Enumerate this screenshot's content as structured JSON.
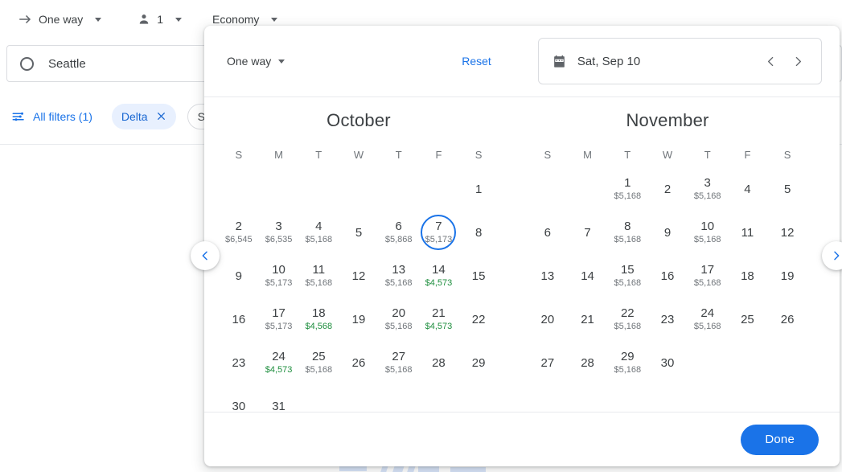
{
  "trip_bar": {
    "trip_type": "One way",
    "passengers": "1",
    "cabin": "Economy",
    "arrow_icon": "arrow-right-icon",
    "person_icon": "person-icon"
  },
  "origin": {
    "value": "Seattle",
    "icon": "circle-outline-icon"
  },
  "filters": {
    "all_filters_label": "All filters (1)",
    "tune_icon": "tune-icon",
    "chips": [
      {
        "label": "Delta",
        "removable": true,
        "close_icon": "close-icon"
      },
      {
        "label": "St",
        "removable": false
      }
    ]
  },
  "modal": {
    "trip_type": "One way",
    "reset_label": "Reset",
    "date_field": {
      "icon": "calendar-icon",
      "value": "Sat, Sep 10",
      "prev_icon": "chevron-left-icon",
      "next_icon": "chevron-right-icon"
    },
    "done_label": "Done",
    "pager_prev_icon": "chevron-left-icon",
    "pager_next_icon": "chevron-right-icon",
    "weekday_headers": [
      "S",
      "M",
      "T",
      "W",
      "T",
      "F",
      "S"
    ],
    "months": [
      {
        "title": "October",
        "weeks": [
          [
            {
              "day": "",
              "price": ""
            },
            {
              "day": "",
              "price": ""
            },
            {
              "day": "",
              "price": ""
            },
            {
              "day": "",
              "price": ""
            },
            {
              "day": "",
              "price": ""
            },
            {
              "day": "",
              "price": ""
            },
            {
              "day": "1",
              "price": ""
            }
          ],
          [
            {
              "day": "2",
              "price": "$6,545"
            },
            {
              "day": "3",
              "price": "$6,535"
            },
            {
              "day": "4",
              "price": "$5,168"
            },
            {
              "day": "5",
              "price": ""
            },
            {
              "day": "6",
              "price": "$5,868"
            },
            {
              "day": "7",
              "price": "$5,173",
              "selected": true
            },
            {
              "day": "8",
              "price": ""
            }
          ],
          [
            {
              "day": "9",
              "price": ""
            },
            {
              "day": "10",
              "price": "$5,173"
            },
            {
              "day": "11",
              "price": "$5,168"
            },
            {
              "day": "12",
              "price": ""
            },
            {
              "day": "13",
              "price": "$5,168"
            },
            {
              "day": "14",
              "price": "$4,573",
              "cheap": true
            },
            {
              "day": "15",
              "price": ""
            }
          ],
          [
            {
              "day": "16",
              "price": ""
            },
            {
              "day": "17",
              "price": "$5,173"
            },
            {
              "day": "18",
              "price": "$4,568",
              "cheap": true
            },
            {
              "day": "19",
              "price": ""
            },
            {
              "day": "20",
              "price": "$5,168"
            },
            {
              "day": "21",
              "price": "$4,573",
              "cheap": true
            },
            {
              "day": "22",
              "price": ""
            }
          ],
          [
            {
              "day": "23",
              "price": ""
            },
            {
              "day": "24",
              "price": "$4,573",
              "cheap": true
            },
            {
              "day": "25",
              "price": "$5,168"
            },
            {
              "day": "26",
              "price": ""
            },
            {
              "day": "27",
              "price": "$5,168"
            },
            {
              "day": "28",
              "price": ""
            },
            {
              "day": "29",
              "price": ""
            }
          ],
          [
            {
              "day": "30",
              "price": ""
            },
            {
              "day": "31",
              "price": ""
            },
            {
              "day": "",
              "price": ""
            },
            {
              "day": "",
              "price": ""
            },
            {
              "day": "",
              "price": ""
            },
            {
              "day": "",
              "price": ""
            },
            {
              "day": "",
              "price": ""
            }
          ]
        ]
      },
      {
        "title": "November",
        "weeks": [
          [
            {
              "day": "",
              "price": ""
            },
            {
              "day": "",
              "price": ""
            },
            {
              "day": "1",
              "price": "$5,168"
            },
            {
              "day": "2",
              "price": ""
            },
            {
              "day": "3",
              "price": "$5,168"
            },
            {
              "day": "4",
              "price": ""
            },
            {
              "day": "5",
              "price": ""
            }
          ],
          [
            {
              "day": "6",
              "price": ""
            },
            {
              "day": "7",
              "price": ""
            },
            {
              "day": "8",
              "price": "$5,168"
            },
            {
              "day": "9",
              "price": ""
            },
            {
              "day": "10",
              "price": "$5,168"
            },
            {
              "day": "11",
              "price": ""
            },
            {
              "day": "12",
              "price": ""
            }
          ],
          [
            {
              "day": "13",
              "price": ""
            },
            {
              "day": "14",
              "price": ""
            },
            {
              "day": "15",
              "price": "$5,168"
            },
            {
              "day": "16",
              "price": ""
            },
            {
              "day": "17",
              "price": "$5,168"
            },
            {
              "day": "18",
              "price": ""
            },
            {
              "day": "19",
              "price": ""
            }
          ],
          [
            {
              "day": "20",
              "price": ""
            },
            {
              "day": "21",
              "price": ""
            },
            {
              "day": "22",
              "price": "$5,168"
            },
            {
              "day": "23",
              "price": ""
            },
            {
              "day": "24",
              "price": "$5,168"
            },
            {
              "day": "25",
              "price": ""
            },
            {
              "day": "26",
              "price": ""
            }
          ],
          [
            {
              "day": "27",
              "price": ""
            },
            {
              "day": "28",
              "price": ""
            },
            {
              "day": "29",
              "price": "$5,168"
            },
            {
              "day": "30",
              "price": ""
            },
            {
              "day": "",
              "price": ""
            },
            {
              "day": "",
              "price": ""
            },
            {
              "day": "",
              "price": ""
            }
          ]
        ]
      }
    ]
  },
  "colors": {
    "accent": "#1a73e8",
    "cheap_price": "#1e8e3e",
    "chip_active_bg": "#e8f0fe",
    "text": "#3c4043",
    "muted": "#70757a"
  }
}
